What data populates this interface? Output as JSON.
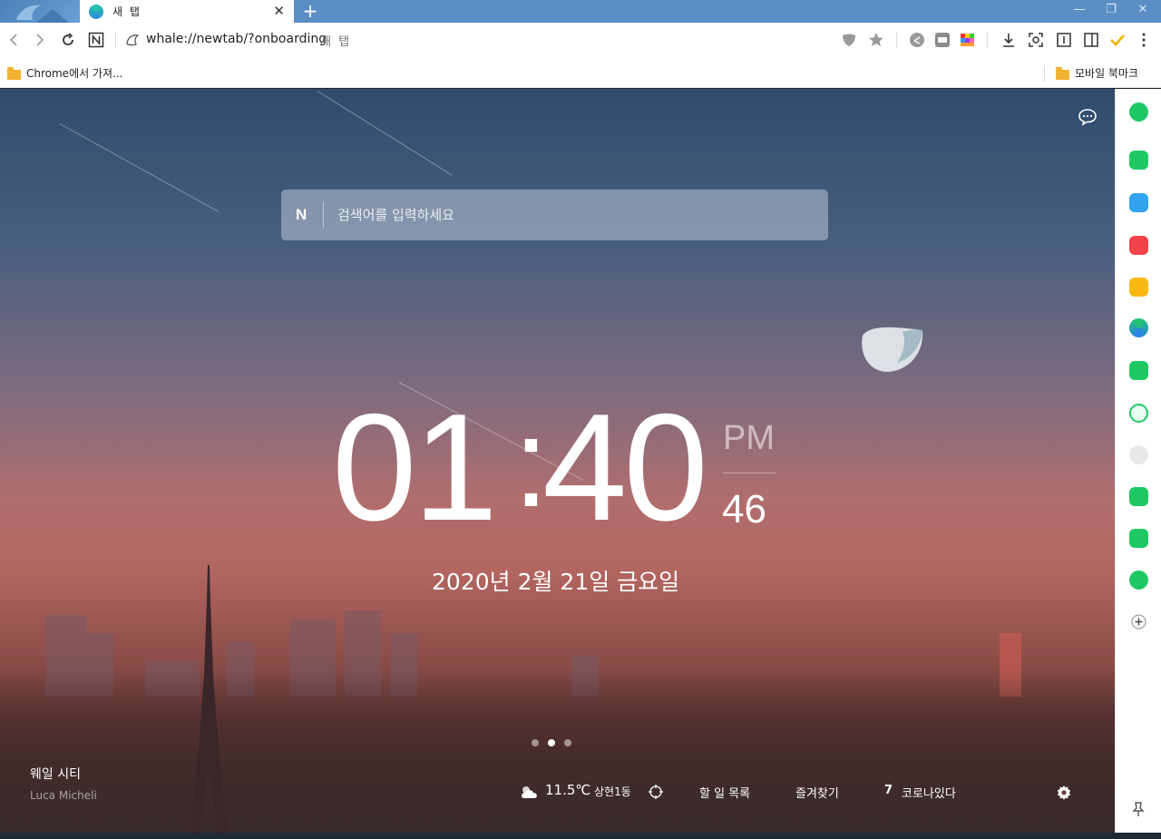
{
  "window": {
    "tab_title": "새 탭",
    "close_tab": "✕",
    "new_tab": "+",
    "minimize": "—",
    "restore": "❐",
    "close": "✕"
  },
  "toolbar": {
    "address": "whale://newtab/?onboarding",
    "page_title": "새 탭"
  },
  "bookmarks": {
    "left_item": "Chrome에서 가져...",
    "right_item": "모바일 북마크"
  },
  "search": {
    "placeholder": "검색어를 입력하세요",
    "logo": "N"
  },
  "clock": {
    "hours": "01",
    "colon": ":",
    "minutes": "40",
    "ampm": "PM",
    "seconds": "46",
    "date": "2020년 2월 21일 금요일"
  },
  "background": {
    "title": "웨일 시티",
    "author": "Luca Micheli"
  },
  "widgets": {
    "temperature": "11.5℃",
    "location": "상현1동",
    "todo": "할 일 목록",
    "favorites": "즐겨찾기",
    "covid_count": "7",
    "covid_label": "코로나있다"
  },
  "colors": {
    "titlebar": "#5b8ec5",
    "sidebar_green": "#1ec964",
    "accent_teal": "#27c6a6"
  }
}
